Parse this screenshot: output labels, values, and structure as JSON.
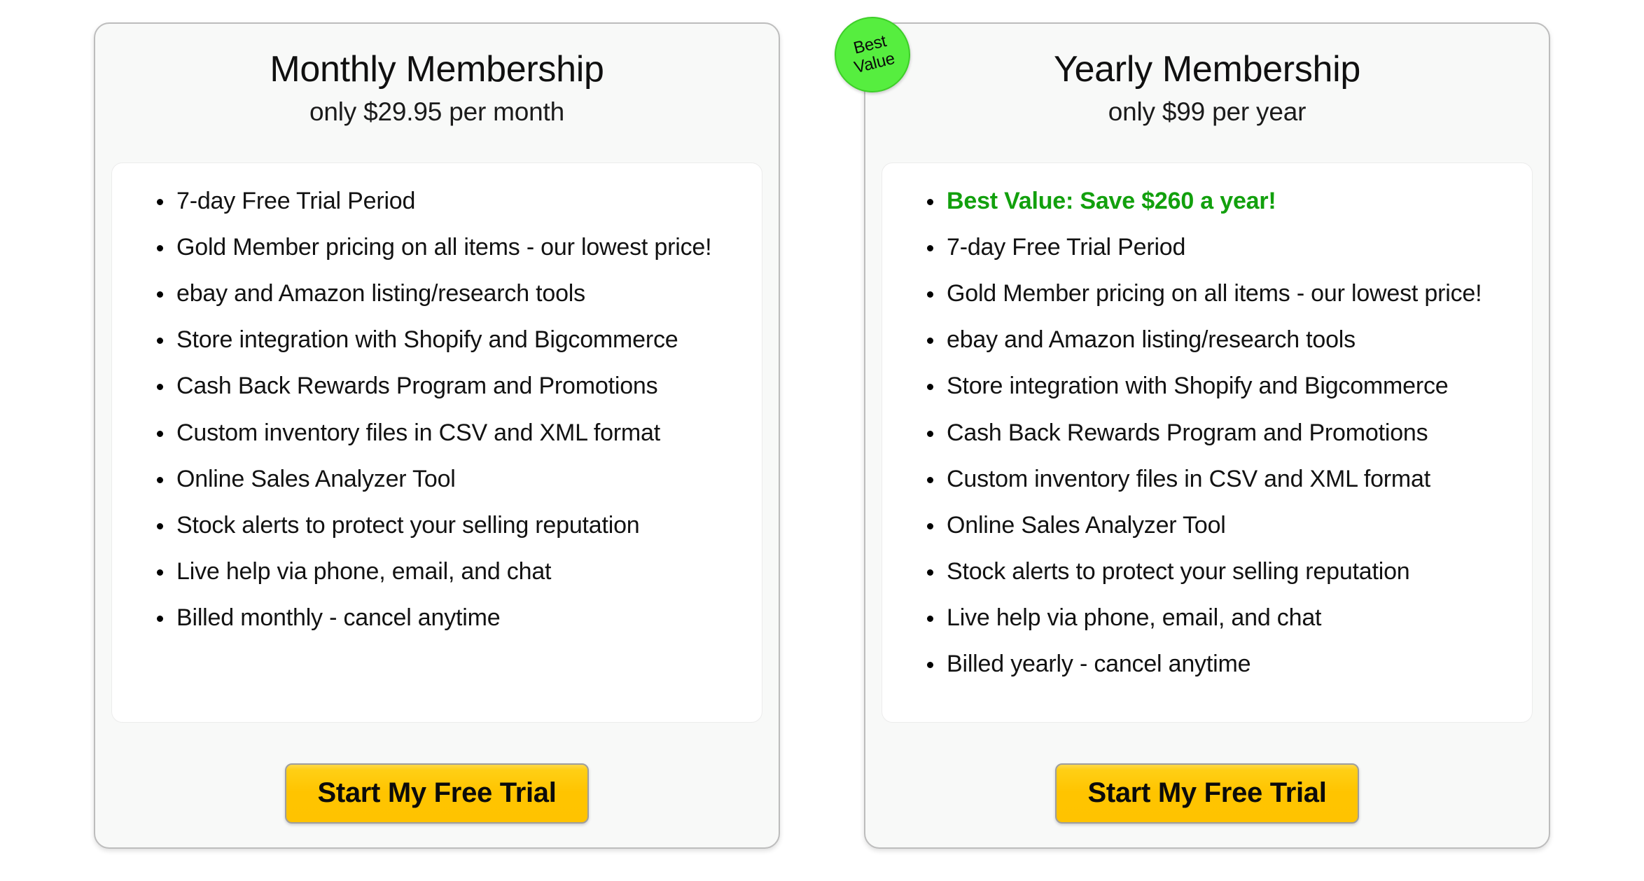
{
  "theme": {
    "page_background": "#ffffff",
    "card_background": "#f8f9f8",
    "card_border": "#bdbdbd",
    "panel_background": "#ffffff",
    "badge_green": "#56ee3f",
    "highlight_green": "#12a00d",
    "button_yellow": "#ffc400",
    "text_color": "#121212"
  },
  "plans": [
    {
      "id": "monthly",
      "title": "Monthly Membership",
      "price_line": "only $29.95 per month",
      "badge": null,
      "features": [
        {
          "text": "7-day Free Trial Period",
          "highlight": false
        },
        {
          "text": "Gold Member pricing on all items - our lowest price!",
          "highlight": false
        },
        {
          "text": "ebay and Amazon listing/research tools",
          "highlight": false
        },
        {
          "text": "Store integration with Shopify and Bigcommerce",
          "highlight": false
        },
        {
          "text": "Cash Back Rewards Program and Promotions",
          "highlight": false
        },
        {
          "text": "Custom inventory files in CSV and XML format",
          "highlight": false
        },
        {
          "text": "Online Sales Analyzer Tool",
          "highlight": false
        },
        {
          "text": "Stock alerts to protect your selling reputation",
          "highlight": false
        },
        {
          "text": "Live help via phone, email, and chat",
          "highlight": false
        },
        {
          "text": "Billed monthly - cancel anytime",
          "highlight": false
        }
      ],
      "cta_label": "Start My Free Trial"
    },
    {
      "id": "yearly",
      "title": "Yearly Membership",
      "price_line": "only $99 per year",
      "badge": {
        "line1": "Best",
        "line2": "Value"
      },
      "features": [
        {
          "text": "Best Value: Save $260 a year!",
          "highlight": true
        },
        {
          "text": "7-day Free Trial Period",
          "highlight": false
        },
        {
          "text": "Gold Member pricing on all items - our lowest price!",
          "highlight": false
        },
        {
          "text": "ebay and Amazon listing/research tools",
          "highlight": false
        },
        {
          "text": "Store integration with Shopify and Bigcommerce",
          "highlight": false
        },
        {
          "text": "Cash Back Rewards Program and Promotions",
          "highlight": false
        },
        {
          "text": "Custom inventory files in CSV and XML format",
          "highlight": false
        },
        {
          "text": "Online Sales Analyzer Tool",
          "highlight": false
        },
        {
          "text": "Stock alerts to protect your selling reputation",
          "highlight": false
        },
        {
          "text": "Live help via phone, email, and chat",
          "highlight": false
        },
        {
          "text": "Billed yearly - cancel anytime",
          "highlight": false
        }
      ],
      "cta_label": "Start My Free Trial"
    }
  ]
}
